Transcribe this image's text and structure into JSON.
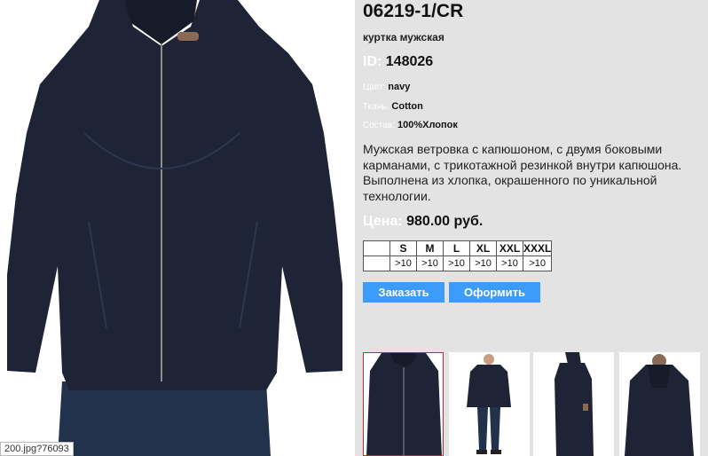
{
  "product": {
    "title": "06219-1/CR",
    "subtitle": "куртка мужская",
    "id_label": "ID:",
    "id_value": "148026",
    "attrs": [
      {
        "label": "Цвет:",
        "value": "navy"
      },
      {
        "label": "Ткань:",
        "value": "Cotton"
      },
      {
        "label": "Состав:",
        "value": "100%Хлопок"
      }
    ],
    "description": "Мужская ветровка с капюшоном, с двумя боковыми карманами, с трикотажной резинкой внутри капюшона. Выполнена из  хлопка, окрашенного по уникальной технологии.",
    "price_label": "Цена:",
    "price_value": "980.00 руб."
  },
  "sizes": {
    "headers": [
      "",
      "S",
      "M",
      "L",
      "XL",
      "XXL",
      "XXXL"
    ],
    "stock": [
      "",
      ">10",
      ">10",
      ">10",
      ">10",
      ">10",
      ">10"
    ]
  },
  "buttons": {
    "order": "Заказать",
    "checkout": "Оформить"
  },
  "image_url_label": "200.jpg?76093",
  "colors": {
    "jacket": "#1e2436",
    "button": "#3d9bfa",
    "selected_border": "#dd2222"
  }
}
